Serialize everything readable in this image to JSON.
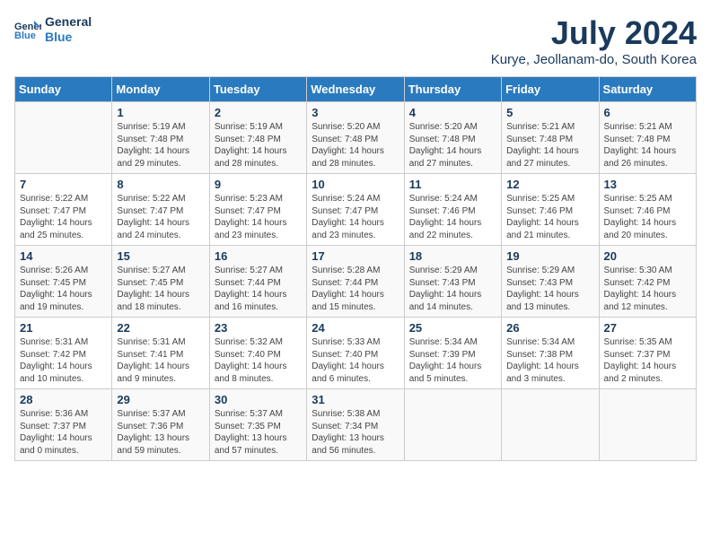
{
  "logo": {
    "line1": "General",
    "line2": "Blue"
  },
  "title": "July 2024",
  "subtitle": "Kurye, Jeollanam-do, South Korea",
  "days": [
    "Sunday",
    "Monday",
    "Tuesday",
    "Wednesday",
    "Thursday",
    "Friday",
    "Saturday"
  ],
  "weeks": [
    [
      {
        "day": "",
        "info": ""
      },
      {
        "day": "1",
        "info": "Sunrise: 5:19 AM\nSunset: 7:48 PM\nDaylight: 14 hours\nand 29 minutes."
      },
      {
        "day": "2",
        "info": "Sunrise: 5:19 AM\nSunset: 7:48 PM\nDaylight: 14 hours\nand 28 minutes."
      },
      {
        "day": "3",
        "info": "Sunrise: 5:20 AM\nSunset: 7:48 PM\nDaylight: 14 hours\nand 28 minutes."
      },
      {
        "day": "4",
        "info": "Sunrise: 5:20 AM\nSunset: 7:48 PM\nDaylight: 14 hours\nand 27 minutes."
      },
      {
        "day": "5",
        "info": "Sunrise: 5:21 AM\nSunset: 7:48 PM\nDaylight: 14 hours\nand 27 minutes."
      },
      {
        "day": "6",
        "info": "Sunrise: 5:21 AM\nSunset: 7:48 PM\nDaylight: 14 hours\nand 26 minutes."
      }
    ],
    [
      {
        "day": "7",
        "info": "Sunrise: 5:22 AM\nSunset: 7:47 PM\nDaylight: 14 hours\nand 25 minutes."
      },
      {
        "day": "8",
        "info": "Sunrise: 5:22 AM\nSunset: 7:47 PM\nDaylight: 14 hours\nand 24 minutes."
      },
      {
        "day": "9",
        "info": "Sunrise: 5:23 AM\nSunset: 7:47 PM\nDaylight: 14 hours\nand 23 minutes."
      },
      {
        "day": "10",
        "info": "Sunrise: 5:24 AM\nSunset: 7:47 PM\nDaylight: 14 hours\nand 23 minutes."
      },
      {
        "day": "11",
        "info": "Sunrise: 5:24 AM\nSunset: 7:46 PM\nDaylight: 14 hours\nand 22 minutes."
      },
      {
        "day": "12",
        "info": "Sunrise: 5:25 AM\nSunset: 7:46 PM\nDaylight: 14 hours\nand 21 minutes."
      },
      {
        "day": "13",
        "info": "Sunrise: 5:25 AM\nSunset: 7:46 PM\nDaylight: 14 hours\nand 20 minutes."
      }
    ],
    [
      {
        "day": "14",
        "info": "Sunrise: 5:26 AM\nSunset: 7:45 PM\nDaylight: 14 hours\nand 19 minutes."
      },
      {
        "day": "15",
        "info": "Sunrise: 5:27 AM\nSunset: 7:45 PM\nDaylight: 14 hours\nand 18 minutes."
      },
      {
        "day": "16",
        "info": "Sunrise: 5:27 AM\nSunset: 7:44 PM\nDaylight: 14 hours\nand 16 minutes."
      },
      {
        "day": "17",
        "info": "Sunrise: 5:28 AM\nSunset: 7:44 PM\nDaylight: 14 hours\nand 15 minutes."
      },
      {
        "day": "18",
        "info": "Sunrise: 5:29 AM\nSunset: 7:43 PM\nDaylight: 14 hours\nand 14 minutes."
      },
      {
        "day": "19",
        "info": "Sunrise: 5:29 AM\nSunset: 7:43 PM\nDaylight: 14 hours\nand 13 minutes."
      },
      {
        "day": "20",
        "info": "Sunrise: 5:30 AM\nSunset: 7:42 PM\nDaylight: 14 hours\nand 12 minutes."
      }
    ],
    [
      {
        "day": "21",
        "info": "Sunrise: 5:31 AM\nSunset: 7:42 PM\nDaylight: 14 hours\nand 10 minutes."
      },
      {
        "day": "22",
        "info": "Sunrise: 5:31 AM\nSunset: 7:41 PM\nDaylight: 14 hours\nand 9 minutes."
      },
      {
        "day": "23",
        "info": "Sunrise: 5:32 AM\nSunset: 7:40 PM\nDaylight: 14 hours\nand 8 minutes."
      },
      {
        "day": "24",
        "info": "Sunrise: 5:33 AM\nSunset: 7:40 PM\nDaylight: 14 hours\nand 6 minutes."
      },
      {
        "day": "25",
        "info": "Sunrise: 5:34 AM\nSunset: 7:39 PM\nDaylight: 14 hours\nand 5 minutes."
      },
      {
        "day": "26",
        "info": "Sunrise: 5:34 AM\nSunset: 7:38 PM\nDaylight: 14 hours\nand 3 minutes."
      },
      {
        "day": "27",
        "info": "Sunrise: 5:35 AM\nSunset: 7:37 PM\nDaylight: 14 hours\nand 2 minutes."
      }
    ],
    [
      {
        "day": "28",
        "info": "Sunrise: 5:36 AM\nSunset: 7:37 PM\nDaylight: 14 hours\nand 0 minutes."
      },
      {
        "day": "29",
        "info": "Sunrise: 5:37 AM\nSunset: 7:36 PM\nDaylight: 13 hours\nand 59 minutes."
      },
      {
        "day": "30",
        "info": "Sunrise: 5:37 AM\nSunset: 7:35 PM\nDaylight: 13 hours\nand 57 minutes."
      },
      {
        "day": "31",
        "info": "Sunrise: 5:38 AM\nSunset: 7:34 PM\nDaylight: 13 hours\nand 56 minutes."
      },
      {
        "day": "",
        "info": ""
      },
      {
        "day": "",
        "info": ""
      },
      {
        "day": "",
        "info": ""
      }
    ]
  ]
}
